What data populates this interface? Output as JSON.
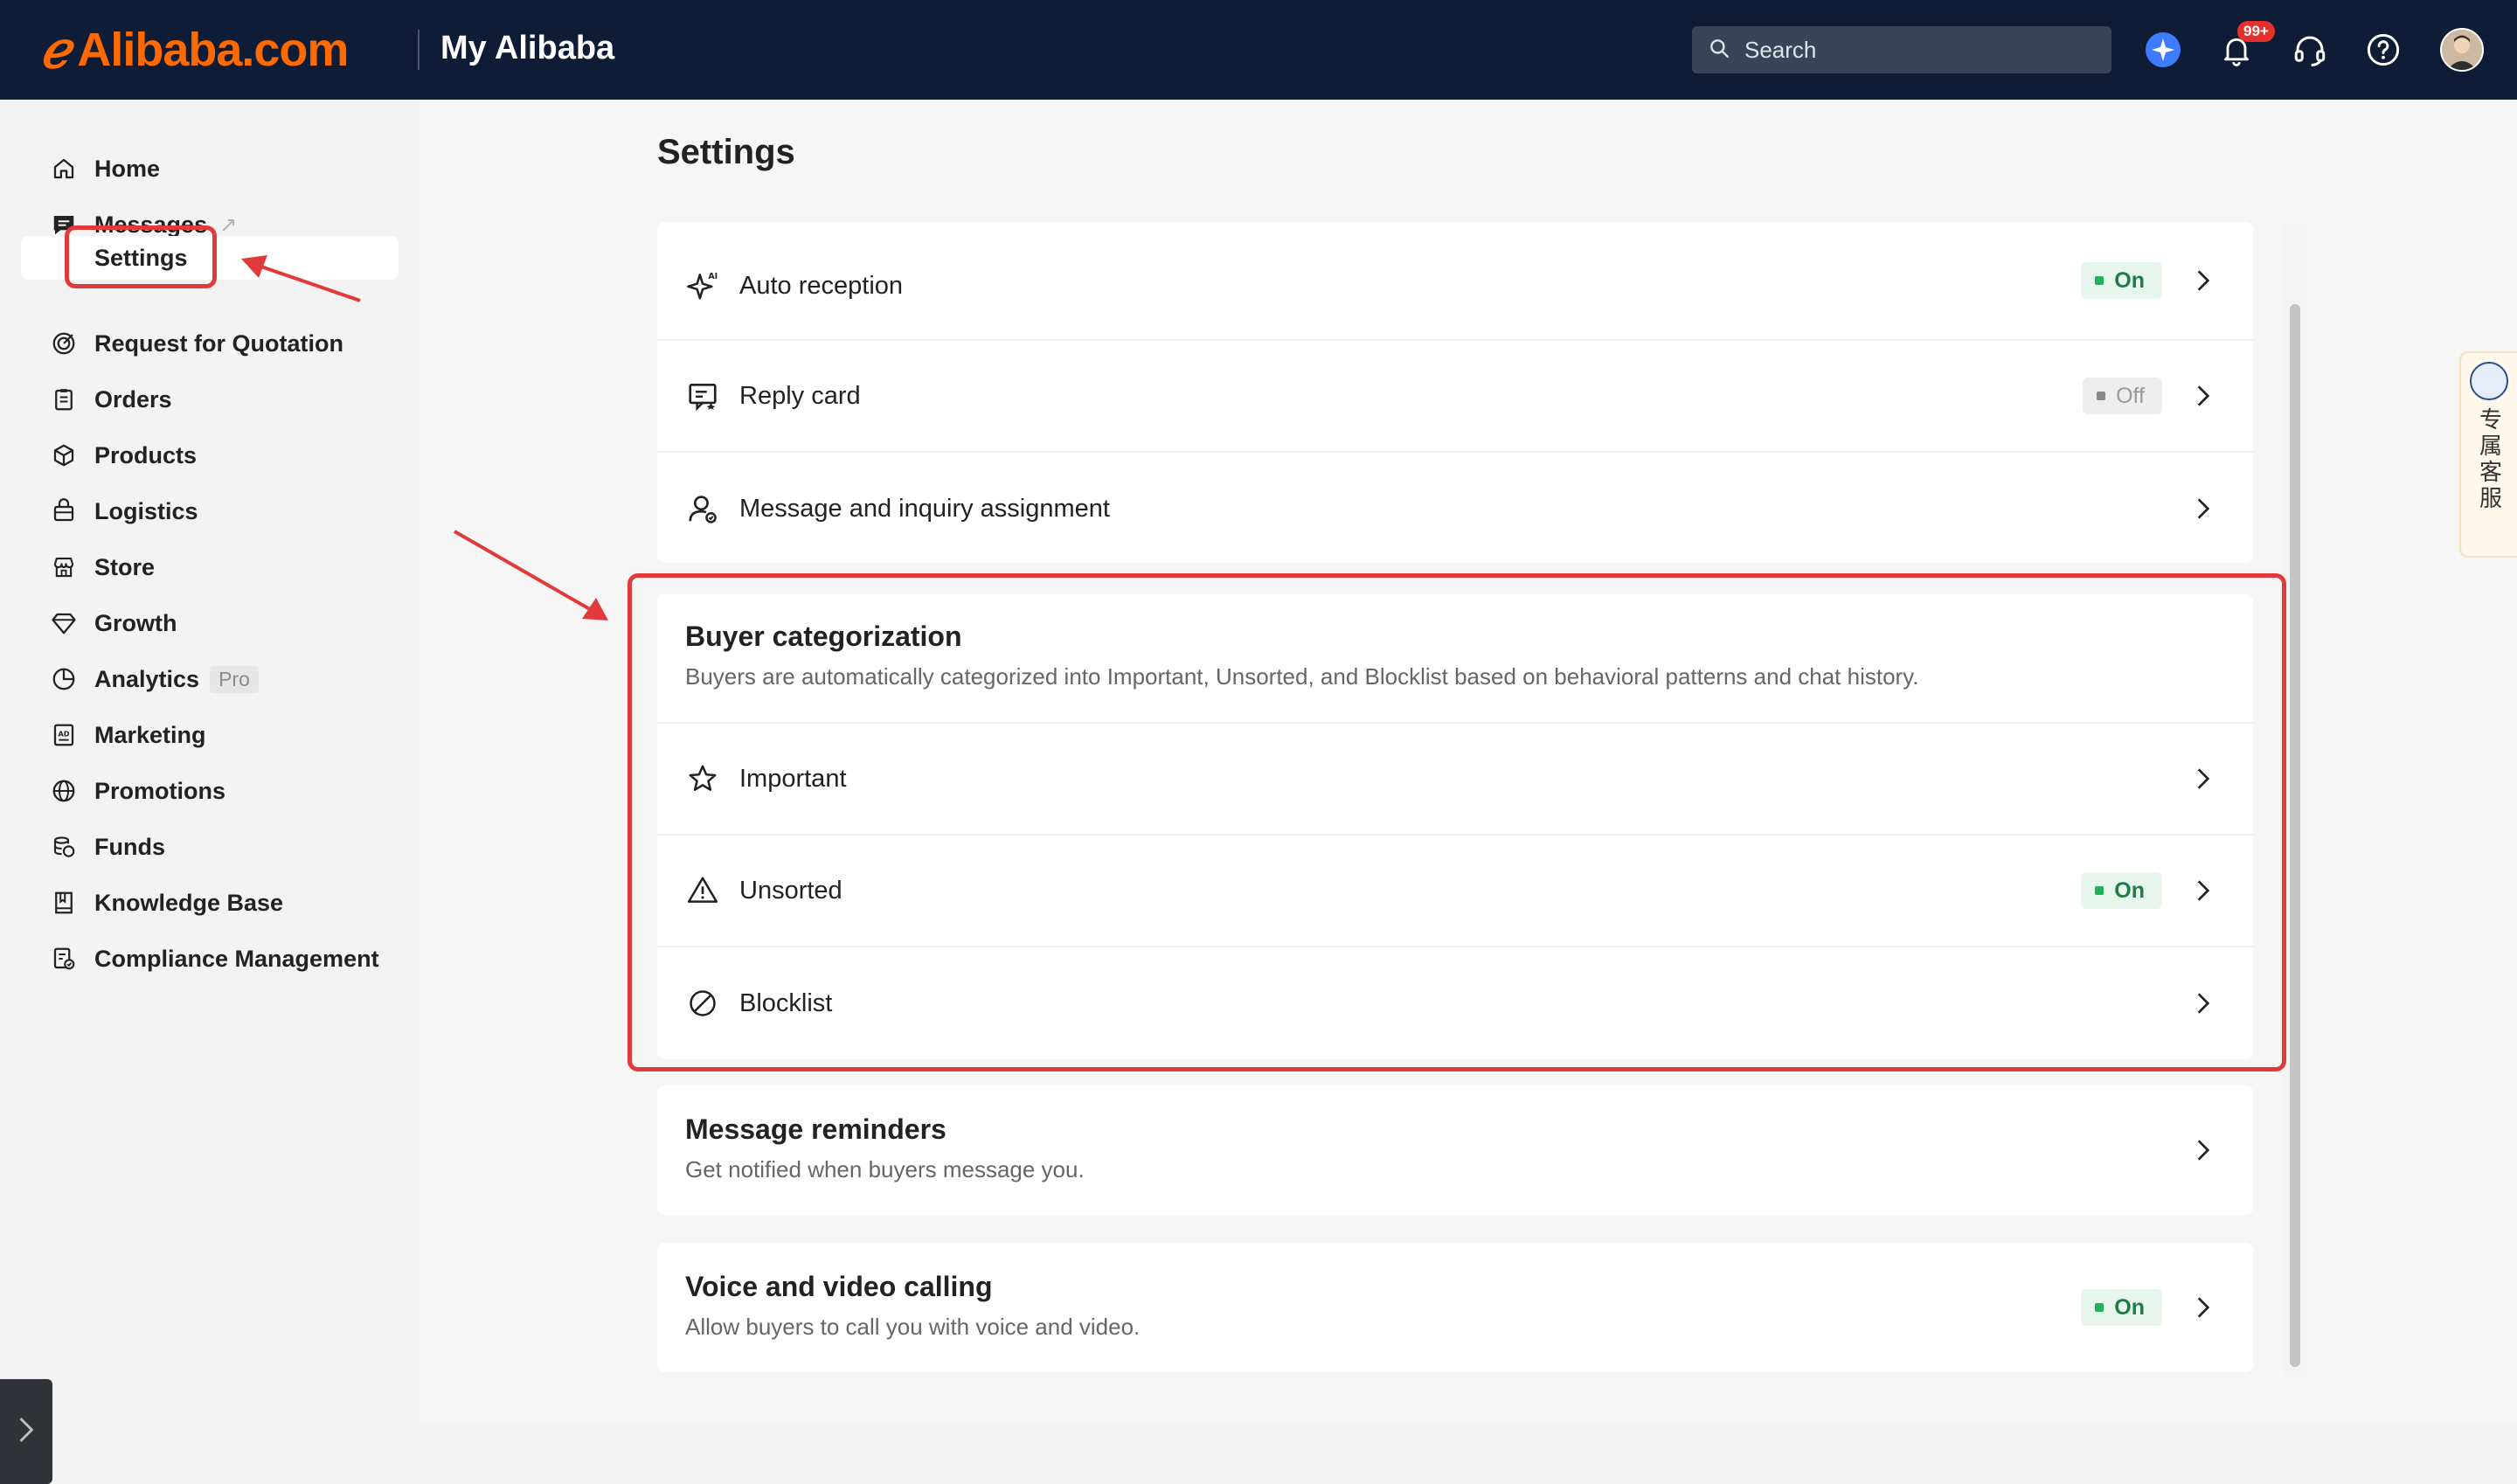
{
  "header": {
    "logo_text": "Alibaba.com",
    "section_title": "My Alibaba",
    "search_placeholder": "Search",
    "notification_badge": "99+"
  },
  "sidebar": {
    "items": [
      {
        "label": "Home",
        "icon": "home-icon"
      },
      {
        "label": "Messages",
        "icon": "message-icon",
        "external": "↗"
      },
      {
        "label": "Settings",
        "active": true
      },
      {
        "label": "Request for Quotation",
        "icon": "target-icon"
      },
      {
        "label": "Orders",
        "icon": "clipboard-icon"
      },
      {
        "label": "Products",
        "icon": "box-icon"
      },
      {
        "label": "Logistics",
        "icon": "truck-icon"
      },
      {
        "label": "Store",
        "icon": "store-icon"
      },
      {
        "label": "Growth",
        "icon": "diamond-icon"
      },
      {
        "label": "Analytics",
        "icon": "pie-icon",
        "tag": "Pro"
      },
      {
        "label": "Marketing",
        "icon": "ad-icon"
      },
      {
        "label": "Promotions",
        "icon": "globe-icon"
      },
      {
        "label": "Funds",
        "icon": "coins-icon"
      },
      {
        "label": "Knowledge Base",
        "icon": "book-icon"
      },
      {
        "label": "Compliance Management",
        "icon": "compliance-icon"
      }
    ]
  },
  "main": {
    "page_title": "Settings",
    "top_card": [
      {
        "label": "Auto reception",
        "status": "On",
        "icon": "ai-sparkle-icon"
      },
      {
        "label": "Reply card",
        "status": "Off",
        "icon": "reply-card-icon"
      },
      {
        "label": "Message and inquiry assignment",
        "status": "",
        "icon": "user-assign-icon"
      }
    ],
    "buyer_categorization": {
      "title": "Buyer categorization",
      "description": "Buyers are automatically categorized into Important, Unsorted, and Blocklist based on behavioral patterns and chat history.",
      "rows": [
        {
          "label": "Important",
          "status": "",
          "icon": "star-icon"
        },
        {
          "label": "Unsorted",
          "status": "On",
          "icon": "warning-icon"
        },
        {
          "label": "Blocklist",
          "status": "",
          "icon": "block-icon"
        }
      ]
    },
    "message_reminders": {
      "title": "Message reminders",
      "description": "Get notified when buyers message you."
    },
    "voice_video": {
      "title": "Voice and video calling",
      "description": "Allow buyers to call you with voice and video.",
      "status": "On"
    }
  },
  "floating_service": {
    "label": "专属客服"
  },
  "colors": {
    "header_bg": "#0f1c36",
    "brand_orange": "#ff6a00",
    "status_on": "#22b05a",
    "annotation_red": "#e03a3a"
  }
}
